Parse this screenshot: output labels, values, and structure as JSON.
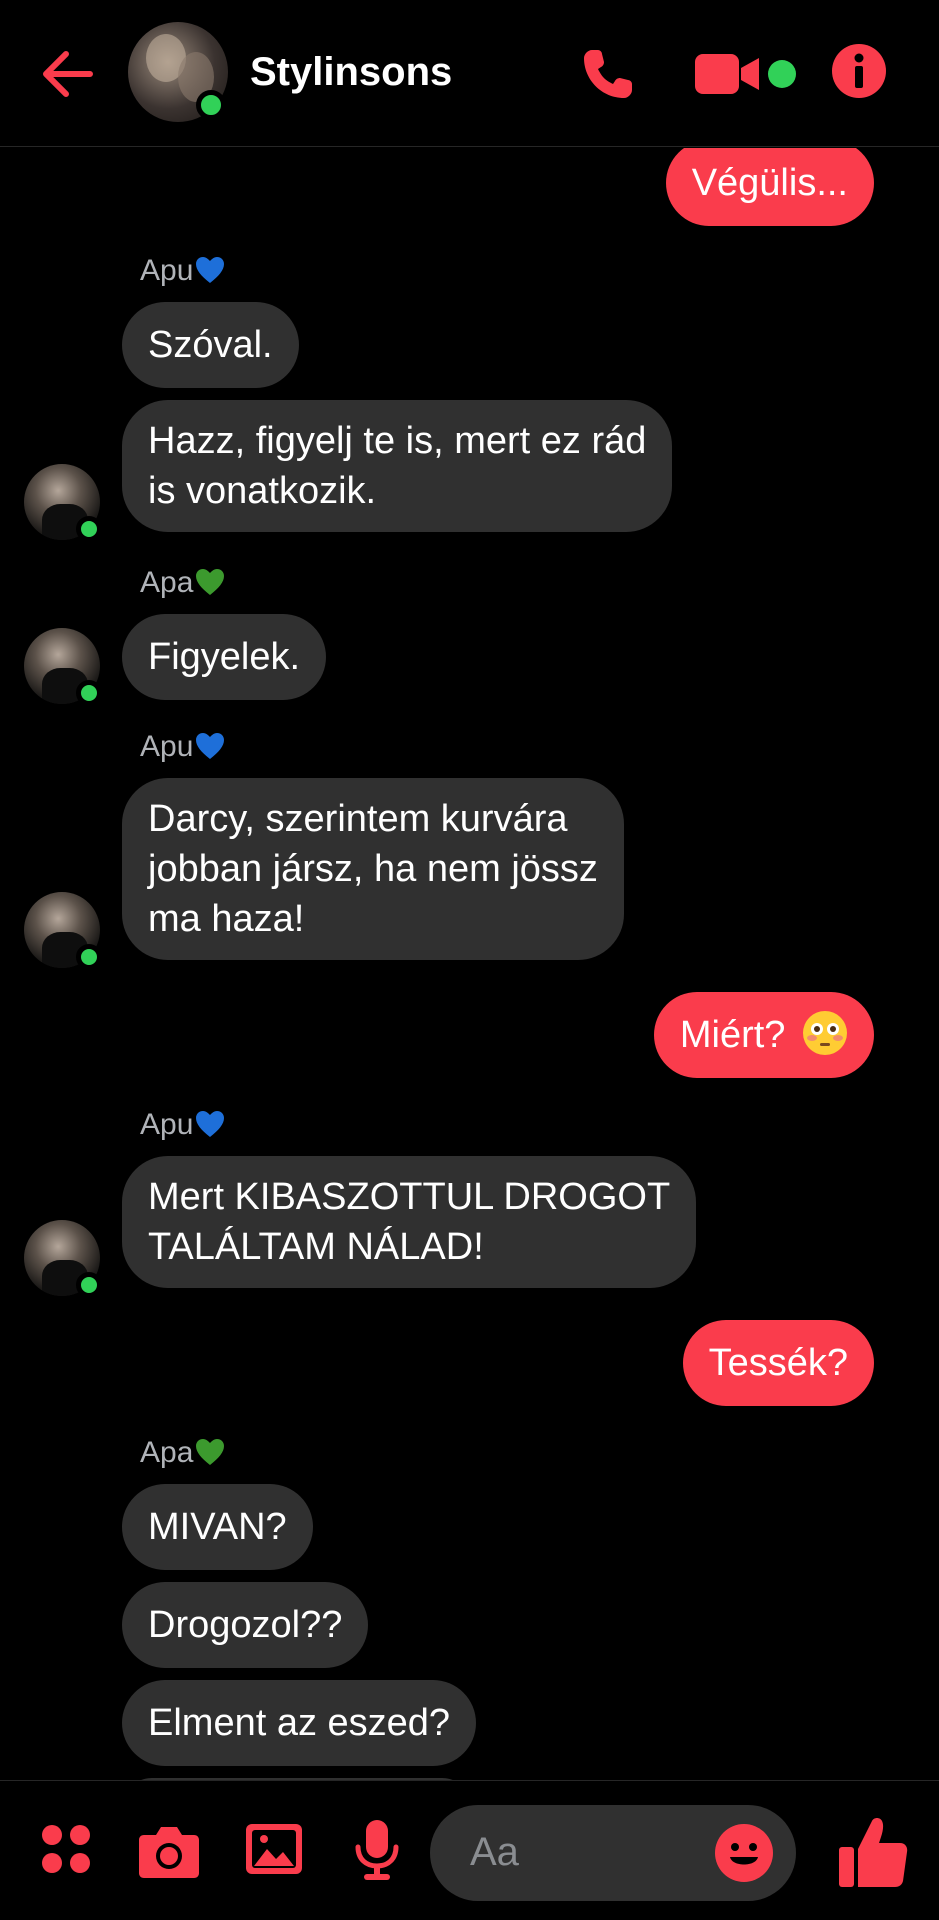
{
  "header": {
    "title": "Stylinsons",
    "back_icon": "arrow-left-icon",
    "call_icon": "phone-icon",
    "video_icon": "video-camera-icon",
    "info_icon": "info-icon",
    "accent_color": "#fa3c4c",
    "online_color": "#31d158"
  },
  "messages": {
    "m1": {
      "text": "Végülis..."
    },
    "m2": {
      "sender": "Apu",
      "heart": "blue-heart",
      "text": "Szóval."
    },
    "m3": {
      "line1": "Hazz, figyelj te is, mert ez rád",
      "line2": "is vonatkozik."
    },
    "m4": {
      "sender": "Apa",
      "heart": "green-heart",
      "text": "Figyelek."
    },
    "m5": {
      "sender": "Apu",
      "heart": "blue-heart",
      "line1": "Darcy, szerintem kurvára",
      "line2": "jobban jársz, ha nem jössz",
      "line3": "ma haza!"
    },
    "m6": {
      "text": "Miért?",
      "emoji": "flushed-face"
    },
    "m7": {
      "sender": "Apu",
      "heart": "blue-heart",
      "line1": "Mert KIBASZOTTUL DROGOT",
      "line2": "TALÁLTAM NÁLAD!"
    },
    "m8": {
      "text": "Tessék?"
    },
    "m9": {
      "sender": "Apa",
      "heart": "green-heart",
      "text": "MIVAN?"
    },
    "m10": {
      "text": "Drogozol??"
    },
    "m11": {
      "text": "Elment az eszed?"
    }
  },
  "composer": {
    "placeholder": "Aa",
    "icons": [
      "apps-icon",
      "camera-icon",
      "gallery-icon",
      "microphone-icon",
      "emoji-icon",
      "thumbs-up-icon"
    ]
  },
  "colors": {
    "incoming_bubble": "#303030",
    "outgoing_bubble": "#fa3c4c",
    "background": "#000000",
    "blue_heart": "#1e6fd9",
    "green_heart": "#3c9a2e"
  }
}
